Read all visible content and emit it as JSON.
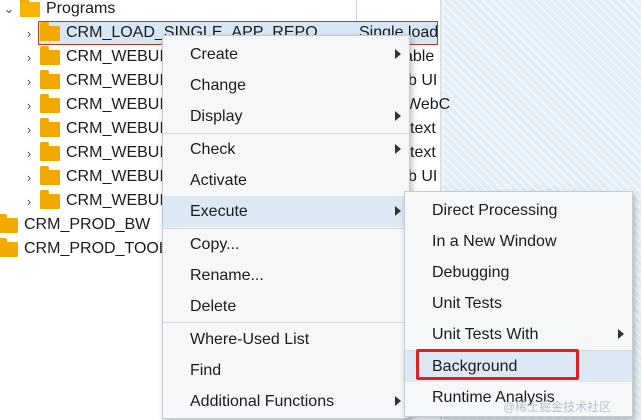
{
  "tree": {
    "root": {
      "label": "Programs"
    },
    "children": [
      {
        "label": "CRM_LOAD_SINGLE_APP_REPO",
        "desc": "Single load"
      },
      {
        "label": "CRM_WEBUI_",
        "desc": "able"
      },
      {
        "label": "CRM_WEBUI_",
        "desc": "b UI"
      },
      {
        "label": "CRM_WEBUI_",
        "desc": "WebC"
      },
      {
        "label": "CRM_WEBUI_",
        "desc": "text"
      },
      {
        "label": "CRM_WEBUI_",
        "desc": "text"
      },
      {
        "label": "CRM_WEBUI_",
        "desc": "b UI"
      },
      {
        "label": "CRM_WEBUI_",
        "desc": ""
      }
    ],
    "siblings": [
      {
        "label": "CRM_PROD_BW"
      },
      {
        "label": "CRM_PROD_TOOL"
      }
    ]
  },
  "context_menu": {
    "items": [
      {
        "label": "Create",
        "submenu": true
      },
      {
        "label": "Change",
        "submenu": false
      },
      {
        "label": "Display",
        "submenu": true
      },
      {
        "label": "Check",
        "submenu": true
      },
      {
        "label": "Activate",
        "submenu": false
      },
      {
        "label": "Execute",
        "submenu": true
      },
      {
        "label": "Copy...",
        "submenu": false
      },
      {
        "label": "Rename...",
        "submenu": false
      },
      {
        "label": "Delete",
        "submenu": false
      },
      {
        "label": "Where-Used List",
        "submenu": false
      },
      {
        "label": "Find",
        "submenu": false
      },
      {
        "label": "Additional Functions",
        "submenu": true
      }
    ]
  },
  "execute_submenu": {
    "items": [
      {
        "label": "Direct Processing"
      },
      {
        "label": "In a New Window"
      },
      {
        "label": "Debugging"
      },
      {
        "label": "Unit Tests"
      },
      {
        "label": "Unit Tests With",
        "submenu": true
      },
      {
        "label": "Background"
      },
      {
        "label": "Runtime Analysis"
      }
    ]
  },
  "watermark": "@稀土掘金技术社区",
  "colors": {
    "selection": "#d6e6f5",
    "highlight": "#e02020",
    "folder": "#f2a900",
    "menu_bg": "#f5f7f9"
  }
}
